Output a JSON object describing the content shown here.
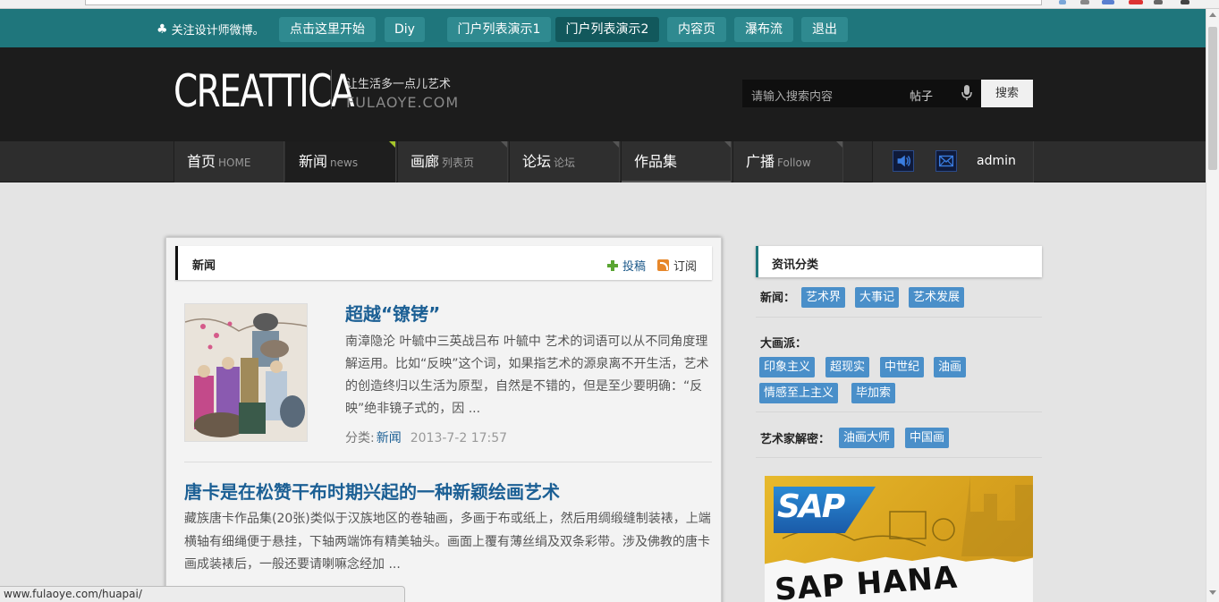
{
  "topbar": {
    "follow_text": "关注设计师微博。",
    "buttons": [
      {
        "label": "点击这里开始"
      },
      {
        "label": "Diy"
      },
      {
        "label": "门户列表演示1"
      },
      {
        "label": "门户列表演示2"
      },
      {
        "label": "内容页"
      },
      {
        "label": "瀑布流"
      },
      {
        "label": "退出"
      }
    ]
  },
  "header": {
    "logo": "CREATTICA",
    "tagline": "让生活多一点儿艺术",
    "subdomain": "FULAOYE.COM",
    "search": {
      "placeholder": "请输入搜索内容",
      "scope": "帖子",
      "button": "搜索"
    }
  },
  "nav": {
    "items": [
      {
        "label": "首页",
        "en": "HOME"
      },
      {
        "label": "新闻",
        "en": "news"
      },
      {
        "label": "画廊",
        "en": "列表页"
      },
      {
        "label": "论坛",
        "en": "论坛"
      },
      {
        "label": "作品集",
        "en": ""
      },
      {
        "label": "广播",
        "en": "Follow"
      }
    ],
    "user": "admin"
  },
  "main": {
    "section_title": "新闻",
    "submit_label": "投稿",
    "subscribe_label": "订阅",
    "posts": [
      {
        "title": "超越“镣铐”",
        "excerpt": "南漳隐沦 叶毓中三英战吕布 叶毓中    艺术的词语可以从不同角度理解运用。比如“反映”这个词，如果指艺术的源泉离不开生活，艺术的创造终归以生活为原型，自然是不错的，但是至少要明确：“反映”绝非镜子式的，因 ...",
        "category_label": "分类:",
        "category": "新闻",
        "date": "2013-7-2 17:57"
      },
      {
        "title": "唐卡是在松赞干布时期兴起的一种新颖绘画艺术",
        "excerpt": "藏族唐卡作品集(20张)类似于汉族地区的卷轴画，多画于布或纸上，然后用绸缎缝制装裱，上端横轴有细绳便于悬挂，下轴两端饰有精美轴头。画面上覆有薄丝绢及双条彩带。涉及佛教的唐卡画成装裱后，一般还要请喇嘛念经加 ..."
      }
    ]
  },
  "sidebar": {
    "title": "资讯分类",
    "groups": [
      {
        "label": "新闻：",
        "tags": [
          "艺术界",
          "大事记",
          "艺术发展"
        ]
      },
      {
        "label": "大画派：",
        "tags": [
          "印象主义",
          "超现实",
          "中世纪",
          "油画",
          "情感至上主义",
          "毕加索"
        ]
      },
      {
        "label": "艺术家解密：",
        "tags": [
          "油画大师",
          "中国画"
        ]
      }
    ],
    "ad": {
      "brand": "SAP",
      "headline": "SAP HANA"
    }
  },
  "statusbar": {
    "url": "www.fulaoye.com/huapai/"
  },
  "colors": {
    "topbar": "#1f767c",
    "header": "#1c1c1c",
    "nav": "#2d2d2d",
    "link": "#1b5f94",
    "tag": "#4a8fc9",
    "nav_active_corner": "#a6c62a"
  },
  "icons": [
    "club-icon",
    "mic-icon",
    "speaker-icon",
    "mail-icon",
    "plus-icon",
    "rss-icon"
  ]
}
